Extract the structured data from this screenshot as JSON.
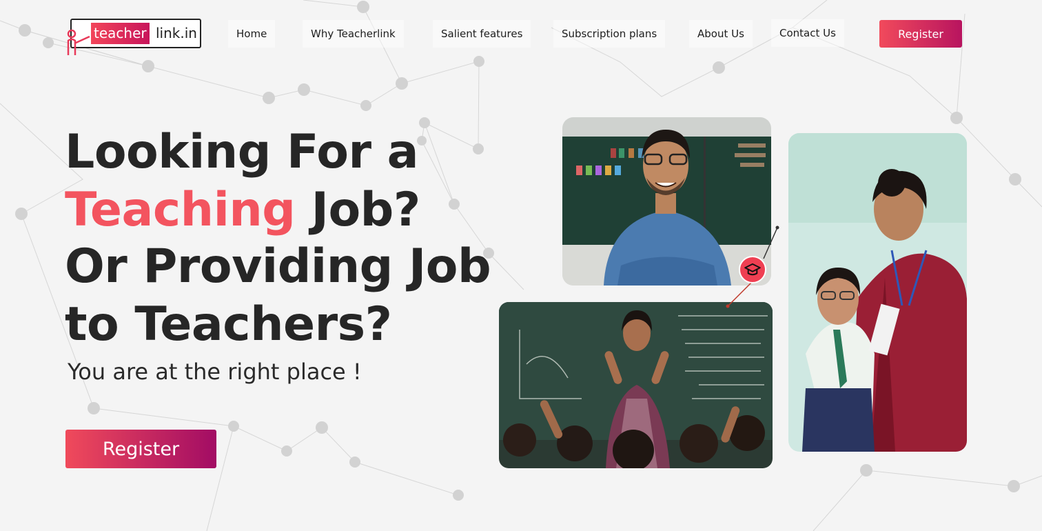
{
  "logo": {
    "part1": "teacher",
    "part2": "link.in"
  },
  "nav": {
    "items": [
      "Home",
      "Why Teacherlink",
      "Salient features",
      "Subscription plans",
      "About Us",
      "Contact Us"
    ],
    "register_label": "Register"
  },
  "hero": {
    "line1": "Looking For a",
    "line2_accent": "Teaching",
    "line2_rest": " Job?",
    "line3": "Or Providing Job",
    "line4": "to Teachers?",
    "subtitle": "You are at the right place !",
    "register_label": "Register"
  },
  "colors": {
    "accent": "#f3545f",
    "brand_gradient_start": "#f04a5b",
    "brand_gradient_end": "#a20c64"
  },
  "icons": {
    "badge": "graduation-cap-icon"
  }
}
